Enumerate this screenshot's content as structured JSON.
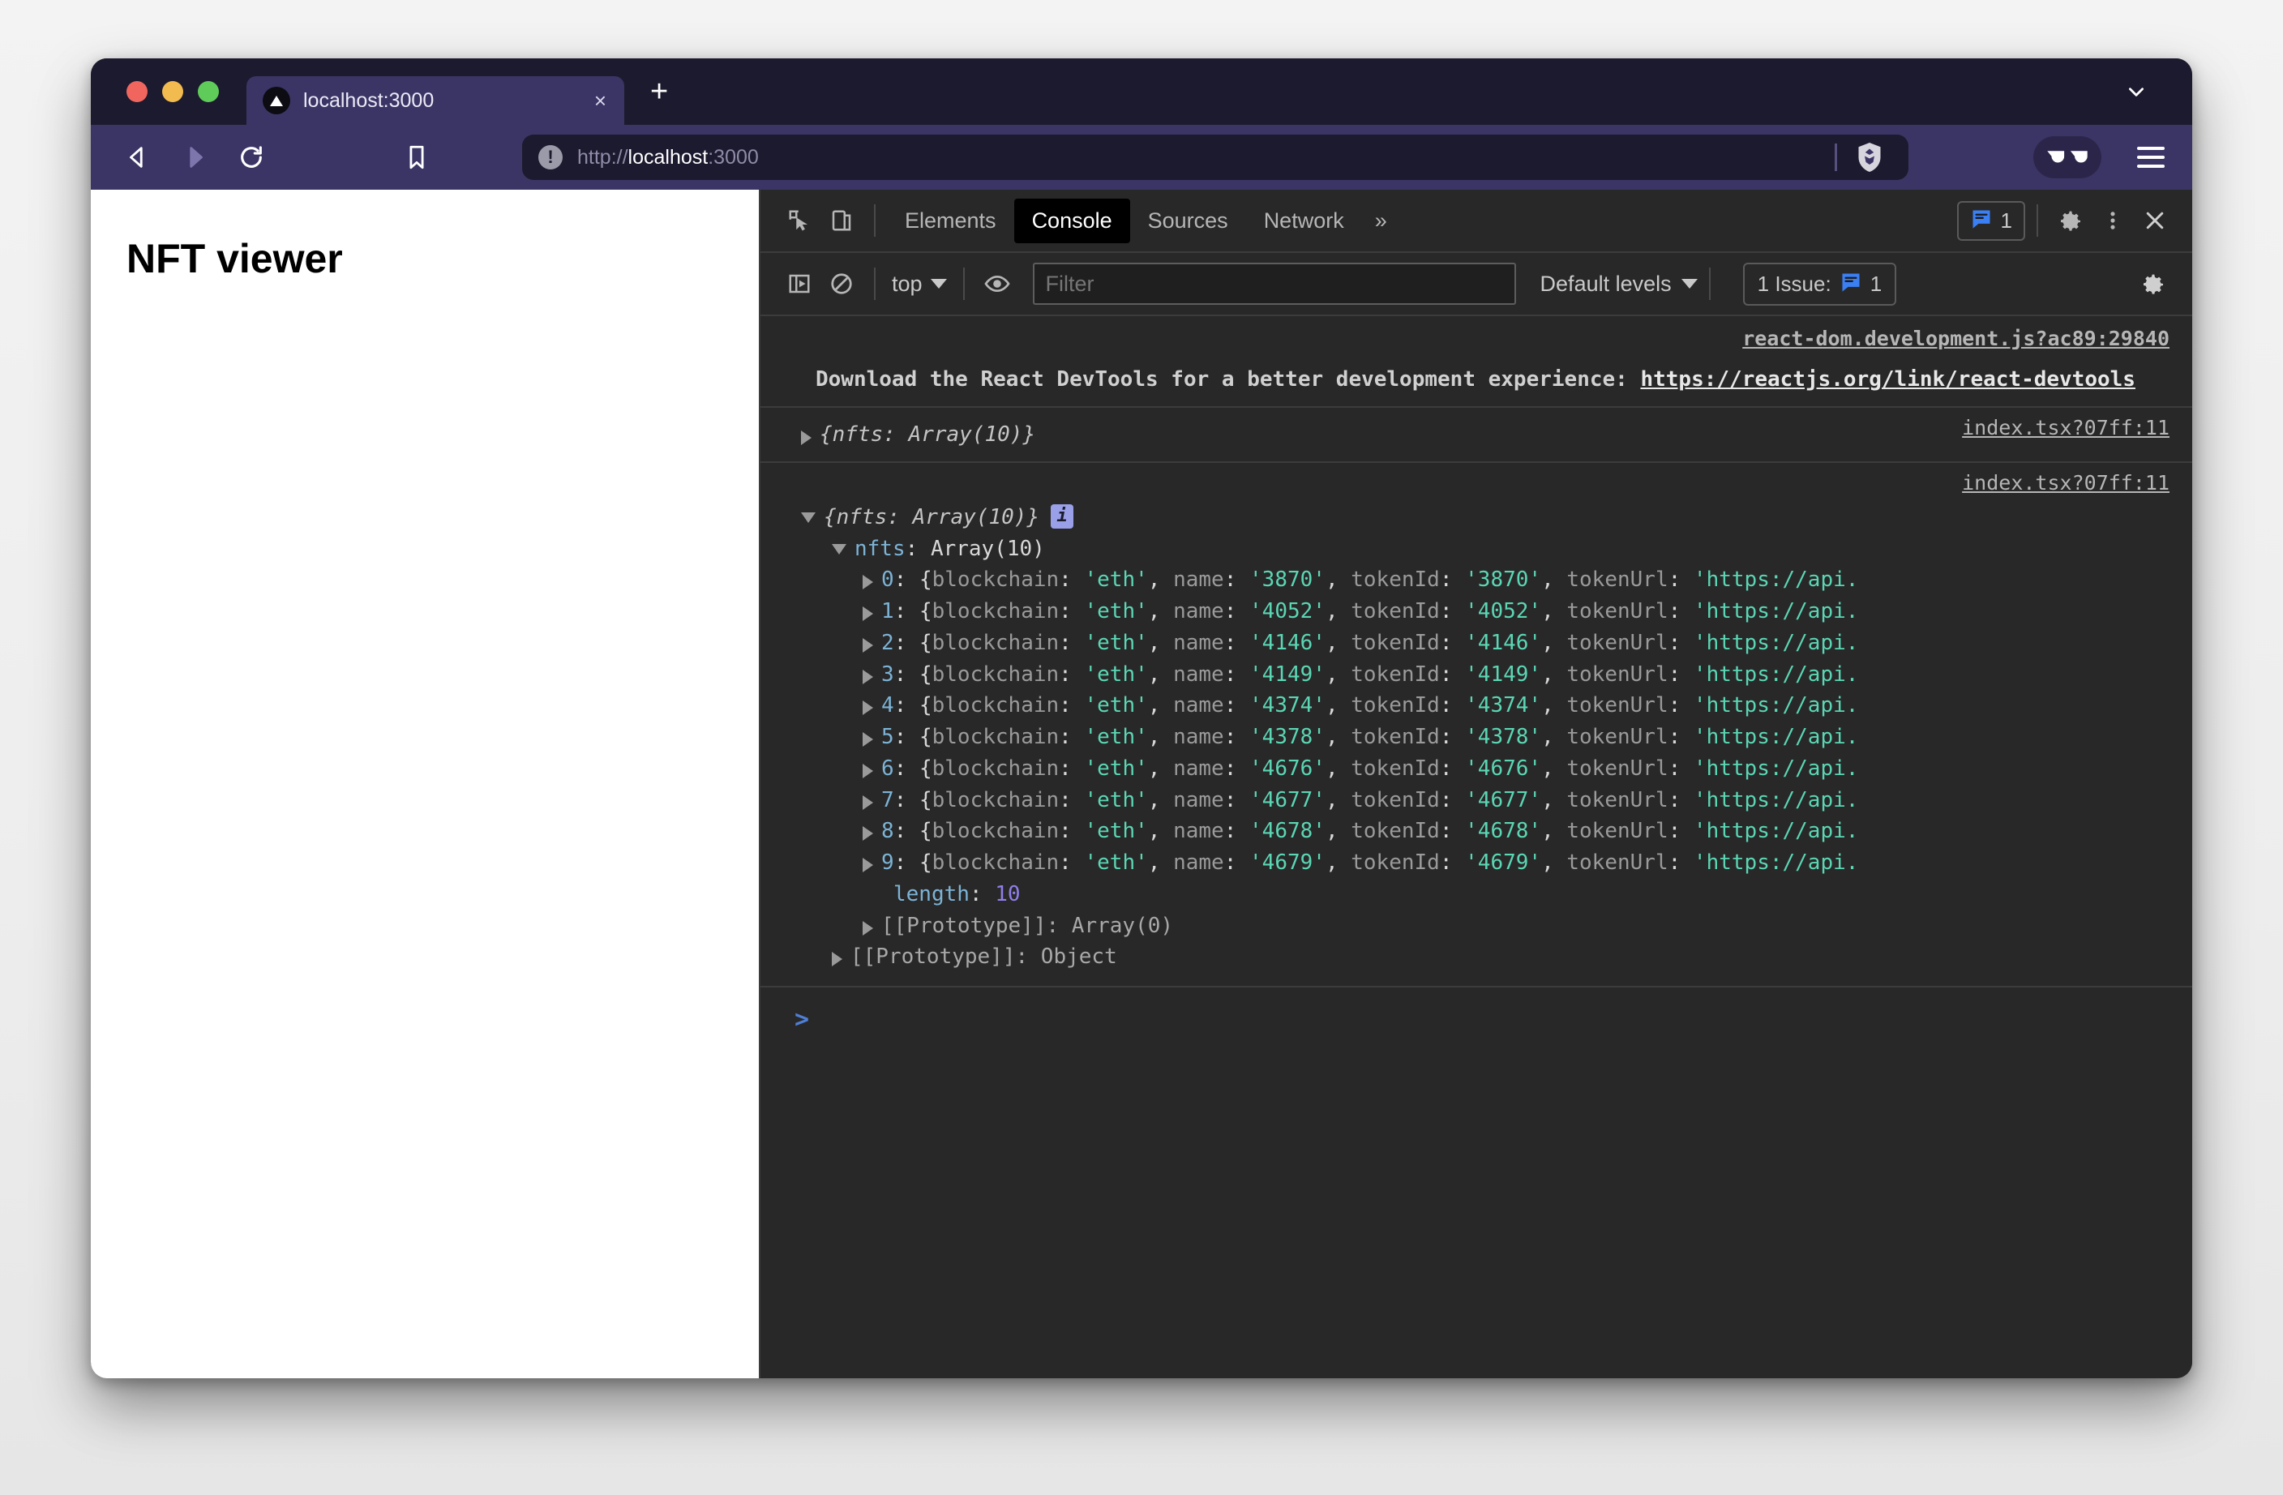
{
  "browser": {
    "tab": {
      "title": "localhost:3000",
      "close_label": "×"
    },
    "new_tab_label": "+",
    "url": {
      "scheme": "http://",
      "host": "localhost",
      "port": ":3000",
      "full": "http://localhost:3000"
    }
  },
  "page": {
    "title": "NFT viewer"
  },
  "devtools": {
    "tabs": [
      {
        "label": "Elements",
        "active": false
      },
      {
        "label": "Console",
        "active": true
      },
      {
        "label": "Sources",
        "active": false
      },
      {
        "label": "Network",
        "active": false
      }
    ],
    "more_label": "»",
    "message_count": "1",
    "filterbar": {
      "context": "top",
      "filter_placeholder": "Filter",
      "filter_value": "",
      "levels": "Default levels",
      "issues_label": "1 Issue:",
      "issues_count": "1"
    }
  },
  "console": {
    "messages": [
      {
        "source": "react-dom.development.js?ac89:29840",
        "text_before": "Download the React DevTools for a better development experience: ",
        "link": "https://reactjs.org/link/react-devtools"
      },
      {
        "source": "index.tsx?07ff:11",
        "head": "{nfts: Array(10)}"
      },
      {
        "source": "index.tsx?07ff:11",
        "head": "{nfts: Array(10)}",
        "badge": "i",
        "prop_name": "nfts",
        "prop_value": "Array(10)",
        "items": [
          {
            "index": "0",
            "blockchain": "'eth'",
            "name": "'3870'",
            "tokenId": "'3870'",
            "tokenUrl": "'https://api."
          },
          {
            "index": "1",
            "blockchain": "'eth'",
            "name": "'4052'",
            "tokenId": "'4052'",
            "tokenUrl": "'https://api."
          },
          {
            "index": "2",
            "blockchain": "'eth'",
            "name": "'4146'",
            "tokenId": "'4146'",
            "tokenUrl": "'https://api."
          },
          {
            "index": "3",
            "blockchain": "'eth'",
            "name": "'4149'",
            "tokenId": "'4149'",
            "tokenUrl": "'https://api."
          },
          {
            "index": "4",
            "blockchain": "'eth'",
            "name": "'4374'",
            "tokenId": "'4374'",
            "tokenUrl": "'https://api."
          },
          {
            "index": "5",
            "blockchain": "'eth'",
            "name": "'4378'",
            "tokenId": "'4378'",
            "tokenUrl": "'https://api."
          },
          {
            "index": "6",
            "blockchain": "'eth'",
            "name": "'4676'",
            "tokenId": "'4676'",
            "tokenUrl": "'https://api."
          },
          {
            "index": "7",
            "blockchain": "'eth'",
            "name": "'4677'",
            "tokenId": "'4677'",
            "tokenUrl": "'https://api."
          },
          {
            "index": "8",
            "blockchain": "'eth'",
            "name": "'4678'",
            "tokenId": "'4678'",
            "tokenUrl": "'https://api."
          },
          {
            "index": "9",
            "blockchain": "'eth'",
            "name": "'4679'",
            "tokenId": "'4679'",
            "tokenUrl": "'https://api."
          }
        ],
        "length_key": "length",
        "length_value": "10",
        "proto_array": "[[Prototype]]: Array(0)",
        "proto_object": "[[Prototype]]: Object"
      }
    ],
    "prompt": ">"
  },
  "colors": {
    "brand_purple": "#3b3566",
    "tabstrip": "#1c1a2e",
    "devtools_bg": "#282828",
    "accent_blue": "#4f7fd4",
    "string_green": "#5bd6b4",
    "number_purple": "#8f7fe8"
  }
}
